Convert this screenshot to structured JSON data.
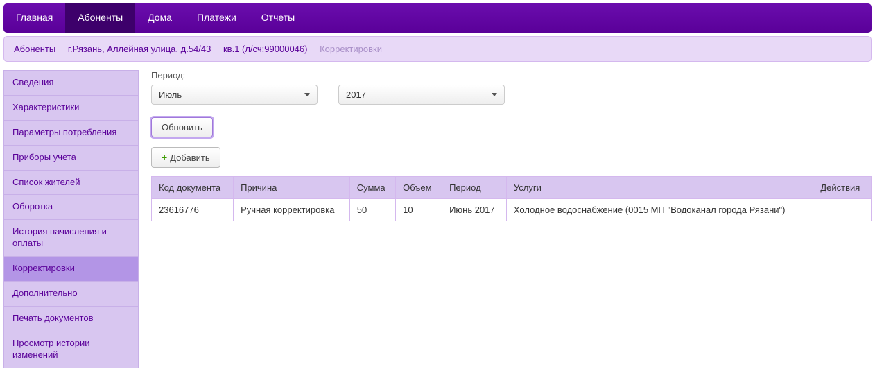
{
  "topnav": {
    "items": [
      {
        "label": "Главная"
      },
      {
        "label": "Абоненты"
      },
      {
        "label": "Дома"
      },
      {
        "label": "Платежи"
      },
      {
        "label": "Отчеты"
      }
    ]
  },
  "breadcrumb": {
    "links": [
      "Абоненты",
      "г.Рязань, Аллейная улица, д.54/43",
      " кв.1 (л/сч:99000046)"
    ],
    "current": "Корректировки"
  },
  "sidebar": {
    "items": [
      "Сведения",
      "Характеристики",
      "Параметры потребления",
      "Приборы учета",
      "Список жителей",
      "Оборотка",
      "История начисления и оплаты",
      "Корректировки",
      "Дополнительно",
      "Печать документов",
      "Просмотр истории изменений"
    ],
    "activeIndex": 7
  },
  "main": {
    "period_label": "Период:",
    "month": "Июль",
    "year": "2017",
    "refresh_label": "Обновить",
    "add_label": "Добавить",
    "table": {
      "headers": [
        "Код документа",
        "Причина",
        "Сумма",
        "Объем",
        "Период",
        "Услуги",
        "Действия"
      ],
      "rows": [
        {
          "code": "23616776",
          "reason": "Ручная корректировка",
          "sum": "50",
          "volume": "10",
          "period": "Июнь 2017",
          "service": "Холодное водоснабжение (0015 МП \"Водоканал города Рязани\")",
          "actions": ""
        }
      ]
    }
  }
}
